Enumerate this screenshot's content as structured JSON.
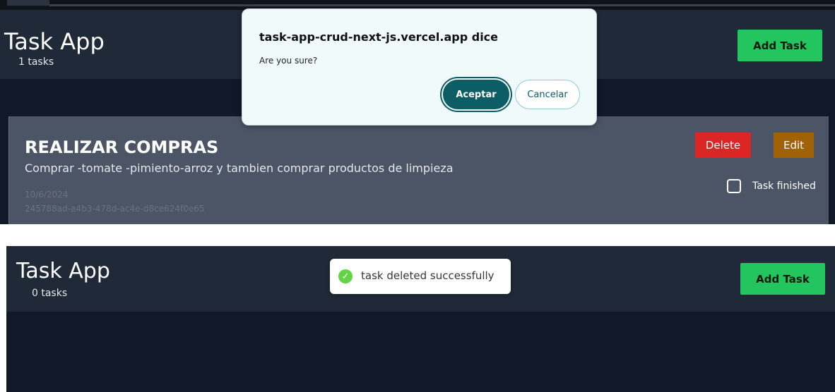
{
  "top": {
    "app_title": "Task App",
    "task_count": "1 tasks",
    "add_button": "Add Task",
    "task": {
      "title": "REALIZAR COMPRAS",
      "description": "Comprar -tomate -pimiento-arroz y tambien comprar productos de limpieza",
      "date": "10/6/2024",
      "id": "245788ad-a4b3-478d-ac4e-d8ce624f0e65",
      "delete_label": "Delete",
      "edit_label": "Edit",
      "finished_label": "Task finished"
    }
  },
  "dialog": {
    "title": "task-app-crud-next-js.vercel.app dice",
    "message": "Are you sure?",
    "ok_label": "Aceptar",
    "cancel_label": "Cancelar"
  },
  "bottom": {
    "app_title": "Task App",
    "task_count": "0 tasks",
    "add_button": "Add Task",
    "toast": {
      "icon": "check-circle-icon",
      "message": "task deleted successfully"
    }
  },
  "colors": {
    "header_bg": "#1f2937",
    "main_bg": "#111827",
    "card_bg": "#4b5565",
    "accent_green": "#22c55e",
    "delete_red": "#dc2626",
    "edit_amber": "#a16207",
    "dialog_primary": "#0c5d66"
  }
}
